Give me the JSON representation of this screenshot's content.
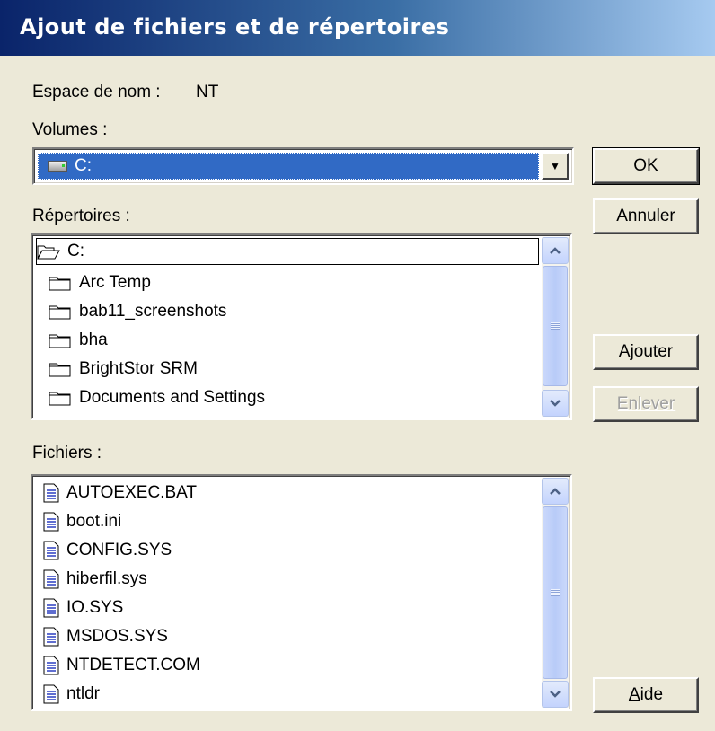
{
  "window": {
    "title": "Ajout de fichiers et de répertoires"
  },
  "namespace": {
    "label": "Espace de nom :",
    "value": "NT"
  },
  "volumes": {
    "label": "Volumes :",
    "selected": "C:",
    "drive_icon": "hard-drive-icon"
  },
  "directories": {
    "label": "Répertoires :",
    "current": "C:",
    "items": [
      "Arc Temp",
      "bab11_screenshots",
      "bha",
      "BrightStor SRM",
      "Documents and Settings"
    ]
  },
  "files": {
    "label": "Fichiers :",
    "items": [
      "AUTOEXEC.BAT",
      "boot.ini",
      "CONFIG.SYS",
      "hiberfil.sys",
      "IO.SYS",
      "MSDOS.SYS",
      "NTDETECT.COM",
      "ntldr"
    ]
  },
  "buttons": {
    "ok": "OK",
    "cancel": "Annuler",
    "add": "Ajouter",
    "remove": "Enlever",
    "help_mnemonic": "A",
    "help_rest": "ide"
  },
  "colors": {
    "selection": "#316ac5",
    "dialog_bg": "#ece9d8",
    "title_start": "#0a246a",
    "title_end": "#a6caf0"
  }
}
